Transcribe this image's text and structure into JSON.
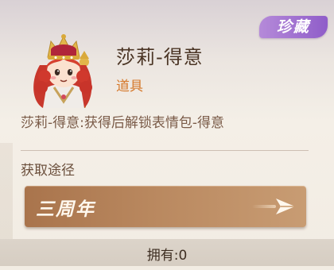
{
  "item": {
    "rarity_badge": "珍藏",
    "name": "莎莉-得意",
    "category": "道具",
    "description": "莎莉-得意:获得后解锁表情包-得意"
  },
  "acquisition": {
    "label": "获取途径",
    "route_label": "三周年",
    "route_arrow_icon": "paper-plane-arrow-icon"
  },
  "ownership": {
    "text": "拥有:0"
  },
  "colors": {
    "badge": "#a375d2",
    "category": "#d5782a",
    "route_button": "#b5845b",
    "title": "#4a3424"
  }
}
